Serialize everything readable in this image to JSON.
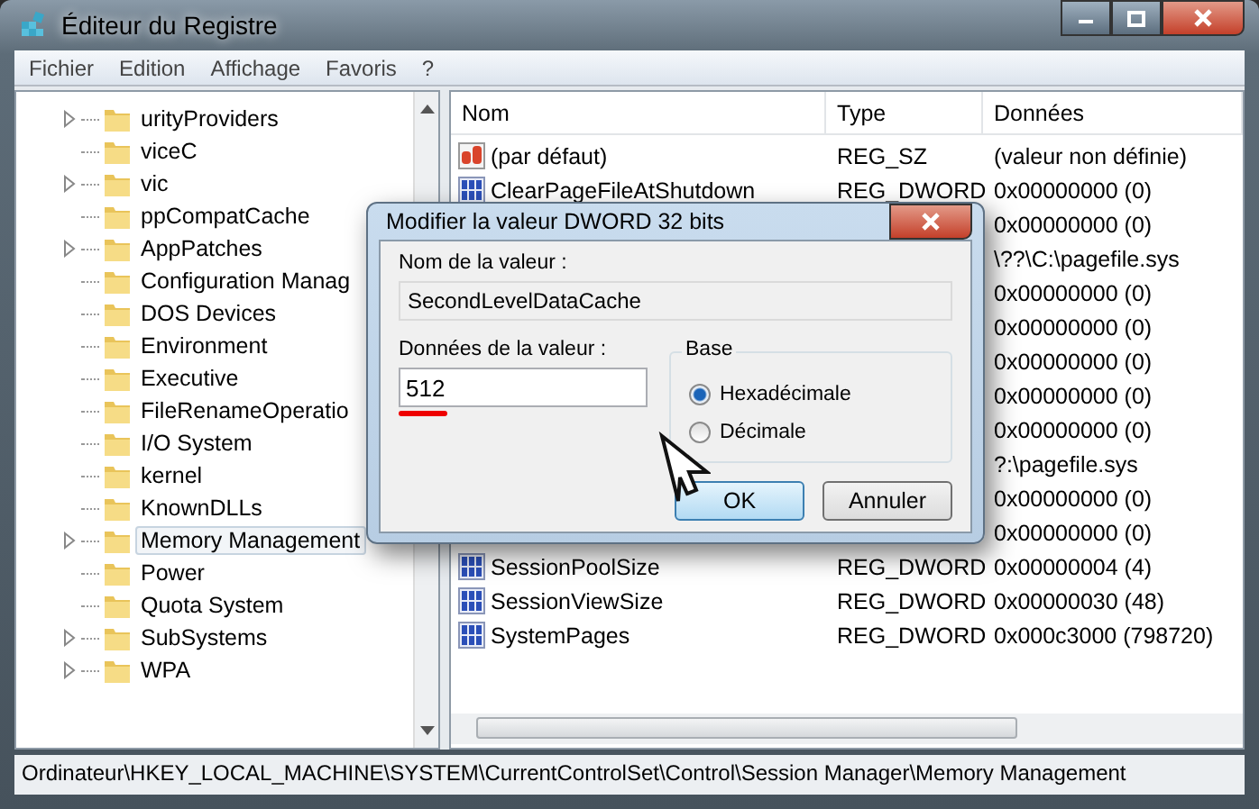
{
  "window": {
    "title": "Éditeur du Registre"
  },
  "menu": [
    "Fichier",
    "Edition",
    "Affichage",
    "Favoris",
    "?"
  ],
  "tree": [
    {
      "label": "urityProviders",
      "has_children": true,
      "selected": false
    },
    {
      "label": "viceC",
      "has_children": false,
      "selected": false
    },
    {
      "label": "vic",
      "has_children": true,
      "selected": false
    },
    {
      "label": "ppCompatCache",
      "has_children": false,
      "selected": false
    },
    {
      "label": "AppPatches",
      "has_children": true,
      "selected": false
    },
    {
      "label": "Configuration Manag",
      "has_children": false,
      "selected": false
    },
    {
      "label": "DOS Devices",
      "has_children": false,
      "selected": false
    },
    {
      "label": "Environment",
      "has_children": false,
      "selected": false
    },
    {
      "label": "Executive",
      "has_children": false,
      "selected": false
    },
    {
      "label": "FileRenameOperatio",
      "has_children": false,
      "selected": false
    },
    {
      "label": "I/O System",
      "has_children": false,
      "selected": false
    },
    {
      "label": "kernel",
      "has_children": false,
      "selected": false
    },
    {
      "label": "KnownDLLs",
      "has_children": false,
      "selected": false
    },
    {
      "label": "Memory Management",
      "has_children": true,
      "selected": true
    },
    {
      "label": "Power",
      "has_children": false,
      "selected": false
    },
    {
      "label": "Quota System",
      "has_children": false,
      "selected": false
    },
    {
      "label": "SubSystems",
      "has_children": true,
      "selected": false
    },
    {
      "label": "WPA",
      "has_children": true,
      "selected": false
    }
  ],
  "list": {
    "columns": [
      "Nom",
      "Type",
      "Données"
    ],
    "rows": [
      {
        "kind": "string",
        "name": "(par défaut)",
        "type": "REG_SZ",
        "data": "(valeur non définie)"
      },
      {
        "kind": "dword",
        "name": "ClearPageFileAtShutdown",
        "type": "REG_DWORD",
        "data": "0x00000000 (0)"
      },
      {
        "kind": "hidden",
        "data": "0x00000000 (0)"
      },
      {
        "kind": "hidden",
        "data": "\\??\\C:\\pagefile.sys"
      },
      {
        "kind": "hidden",
        "data": "0x00000000 (0)"
      },
      {
        "kind": "hidden",
        "data": "0x00000000 (0)"
      },
      {
        "kind": "hidden",
        "data": "0x00000000 (0)"
      },
      {
        "kind": "hidden",
        "data": "0x00000000 (0)"
      },
      {
        "kind": "hidden",
        "data": "0x00000000 (0)"
      },
      {
        "kind": "hidden",
        "data": "?:\\pagefile.sys"
      },
      {
        "kind": "hidden",
        "data": "0x00000000 (0)"
      },
      {
        "kind": "hidden",
        "data": "0x00000000 (0)"
      },
      {
        "kind": "dword",
        "name": "SessionPoolSize",
        "type": "REG_DWORD",
        "data": "0x00000004 (4)"
      },
      {
        "kind": "dword",
        "name": "SessionViewSize",
        "type": "REG_DWORD",
        "data": "0x00000030 (48)"
      },
      {
        "kind": "dword",
        "name": "SystemPages",
        "type": "REG_DWORD",
        "data": "0x000c3000 (798720)"
      }
    ]
  },
  "status_bar": "Ordinateur\\HKEY_LOCAL_MACHINE\\SYSTEM\\CurrentControlSet\\Control\\Session Manager\\Memory Management",
  "dialog": {
    "title": "Modifier la valeur DWORD 32 bits",
    "name_label": "Nom de la valeur :",
    "name_value": "SecondLevelDataCache",
    "data_label": "Données de la valeur :",
    "data_value": "512",
    "base_label": "Base",
    "radios": [
      {
        "label": "Hexadécimale",
        "selected": true
      },
      {
        "label": "Décimale",
        "selected": false
      }
    ],
    "buttons": [
      {
        "label": "OK",
        "default": true
      },
      {
        "label": "Annuler",
        "default": false
      }
    ]
  }
}
